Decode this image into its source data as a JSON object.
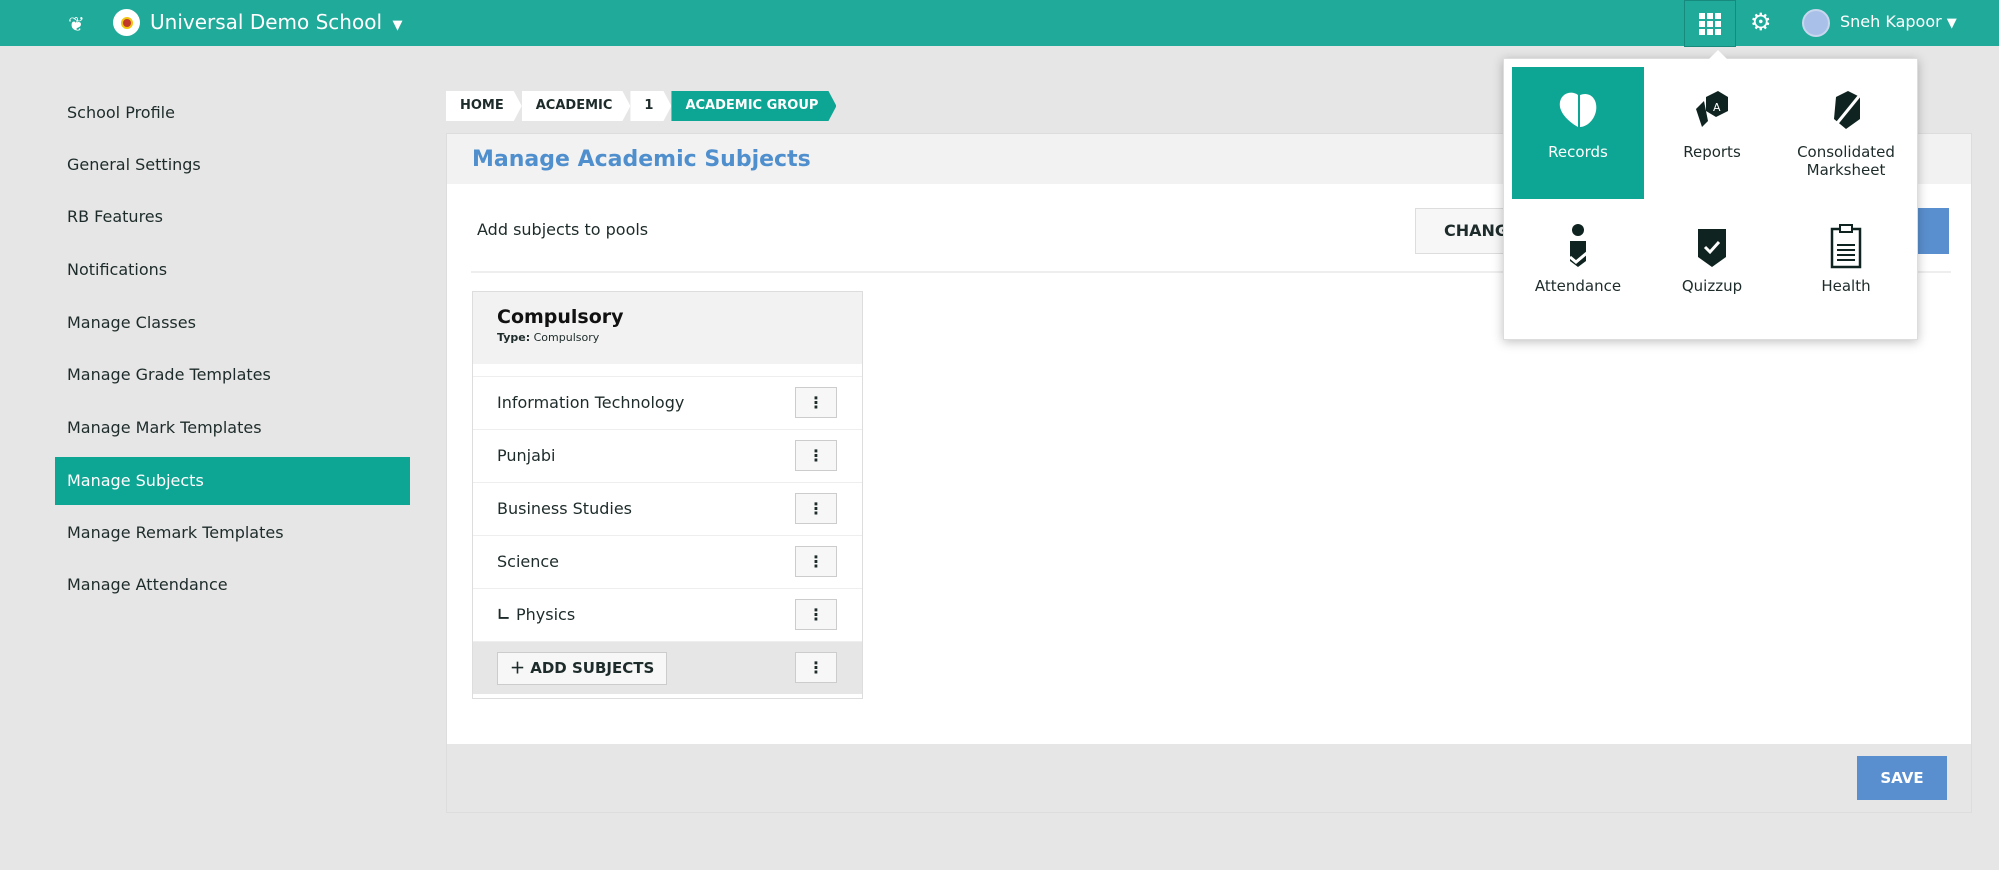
{
  "topbar": {
    "school": "Universal Demo School",
    "user": "Sneh Kapoor"
  },
  "sidebar": {
    "items": [
      {
        "label": "School Profile"
      },
      {
        "label": "General Settings"
      },
      {
        "label": "RB Features"
      },
      {
        "label": "Notifications"
      },
      {
        "label": "Manage Classes"
      },
      {
        "label": "Manage Grade Templates"
      },
      {
        "label": "Manage Mark Templates"
      },
      {
        "label": "Manage Subjects",
        "active": true
      },
      {
        "label": "Manage Remark Templates"
      },
      {
        "label": "Manage Attendance"
      }
    ]
  },
  "breadcrumb": [
    "HOME",
    "ACADEMIC",
    "1",
    "ACADEMIC GROUP"
  ],
  "main": {
    "title": "Manage Academic Subjects",
    "intro": "Add subjects to pools",
    "change_label": "CHANG",
    "pool": {
      "title": "Compulsory",
      "type_label": "Type:",
      "type_value": "Compulsory",
      "subjects": [
        "Information Technology",
        "Punjabi",
        "Business Studies",
        "Science",
        "Physics"
      ],
      "add_label": "ADD SUBJECTS"
    },
    "save_label": "SAVE"
  },
  "apps_menu": {
    "items": [
      {
        "label": "Records",
        "icon": "records-icon"
      },
      {
        "label": "Reports",
        "icon": "reports-icon"
      },
      {
        "label": "Consolidated Marksheet",
        "icon": "marksheet-icon"
      },
      {
        "label": "Attendance",
        "icon": "attendance-icon"
      },
      {
        "label": "Quizzup",
        "icon": "quizzup-icon"
      },
      {
        "label": "Health",
        "icon": "health-icon"
      }
    ]
  },
  "colors": {
    "topbar": "#1faa9a",
    "accent": "#0da593",
    "primary_button": "#5a8fcf",
    "title": "#4f8fcd"
  }
}
